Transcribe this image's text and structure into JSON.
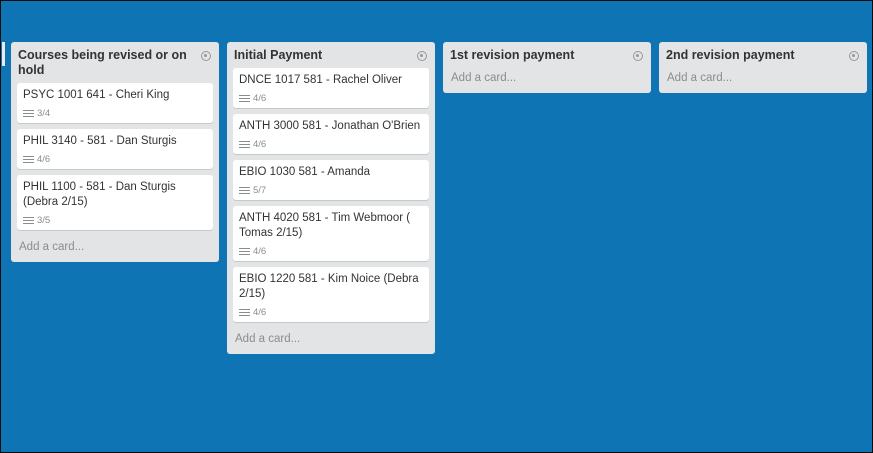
{
  "lists": [
    {
      "title": "Courses being revised or on hold",
      "cards": [
        {
          "title": "PSYC 1001 641 - Cheri King",
          "checklist": "3/4"
        },
        {
          "title": "PHIL 3140 - 581 - Dan Sturgis",
          "checklist": "4/6"
        },
        {
          "title": "PHIL 1100 - 581 - Dan Sturgis (Debra 2/15)",
          "checklist": "3/5"
        }
      ],
      "add_card": "Add a card..."
    },
    {
      "title": "Initial Payment",
      "cards": [
        {
          "title": "DNCE 1017 581 - Rachel Oliver",
          "checklist": "4/6"
        },
        {
          "title": "ANTH 3000 581 - Jonathan O'Brien",
          "checklist": "4/6"
        },
        {
          "title": "EBIO 1030 581 - Amanda",
          "checklist": "5/7"
        },
        {
          "title": "ANTH 4020 581 - Tim Webmoor ( Tomas 2/15)",
          "checklist": "4/6"
        },
        {
          "title": "EBIO 1220 581 - Kim Noice (Debra 2/15)",
          "checklist": "4/6"
        }
      ],
      "add_card": "Add a card..."
    },
    {
      "title": "1st revision payment",
      "cards": [],
      "add_card": "Add a card..."
    },
    {
      "title": "2nd revision payment",
      "cards": [],
      "add_card": "Add a card..."
    }
  ],
  "icons": {
    "list_menu": "circle-menu-icon",
    "checklist": "checklist-icon"
  },
  "colors": {
    "board_background": "#0e74b3",
    "list_background": "#e2e4e6",
    "card_background": "#ffffff"
  }
}
